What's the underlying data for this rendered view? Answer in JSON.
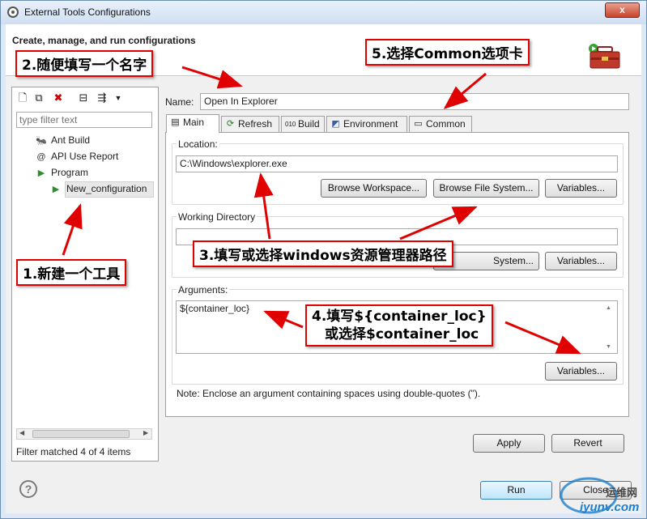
{
  "window": {
    "title": "External Tools Configurations",
    "close_label": "x"
  },
  "header": {
    "title": "Create, manage, and run configurations"
  },
  "left_panel": {
    "filter_placeholder": "type filter text",
    "toolbar_icons": [
      "new-config-icon",
      "duplicate-icon",
      "delete-icon",
      "collapse-all-icon",
      "filter-icon",
      "dropdown-icon"
    ],
    "tree": [
      {
        "label": "Ant Build",
        "icon": "ant-icon"
      },
      {
        "label": "API Use Report",
        "icon": "api-report-icon"
      },
      {
        "label": "Program",
        "icon": "program-icon"
      },
      {
        "label": "New_configuration",
        "icon": "program-config-icon",
        "selected": true
      }
    ],
    "status": "Filter matched 4 of 4 items"
  },
  "config": {
    "name_label": "Name:",
    "name_value": "Open In Explorer",
    "tabs": [
      {
        "label": "Main",
        "icon": "main-tab-icon",
        "active": true
      },
      {
        "label": "Refresh",
        "icon": "refresh-tab-icon"
      },
      {
        "label": "Build",
        "icon": "build-tab-icon"
      },
      {
        "label": "Environment",
        "icon": "environment-tab-icon"
      },
      {
        "label": "Common",
        "icon": "common-tab-icon"
      }
    ],
    "location": {
      "label": "Location:",
      "value": "C:\\Windows\\explorer.exe",
      "browse_workspace": "Browse Workspace...",
      "browse_filesystem": "Browse File System...",
      "variables": "Variables..."
    },
    "working_directory": {
      "label": "Working Directory",
      "value": "",
      "browse_filesystem_partial": "System...",
      "variables": "Variables..."
    },
    "arguments": {
      "label": "Arguments:",
      "value": "${container_loc}",
      "variables": "Variables..."
    },
    "note": "Note: Enclose an argument containing spaces using double-quotes (\").",
    "apply": "Apply",
    "revert": "Revert"
  },
  "footer": {
    "run": "Run",
    "close": "Close"
  },
  "annotations": {
    "step1": "1.新建一个工具",
    "step2": "2.随便填写一个名字",
    "step3": "3.填写或选择windows资源管理器路径",
    "step4_line1": "4.填写${container_loc}",
    "step4_line2": "或选择$container_loc",
    "step5": "5.选择Common选项卡",
    "arrow_color": "#e00000"
  },
  "watermark": {
    "line1": "运维网",
    "line2": "iyunv.com"
  }
}
